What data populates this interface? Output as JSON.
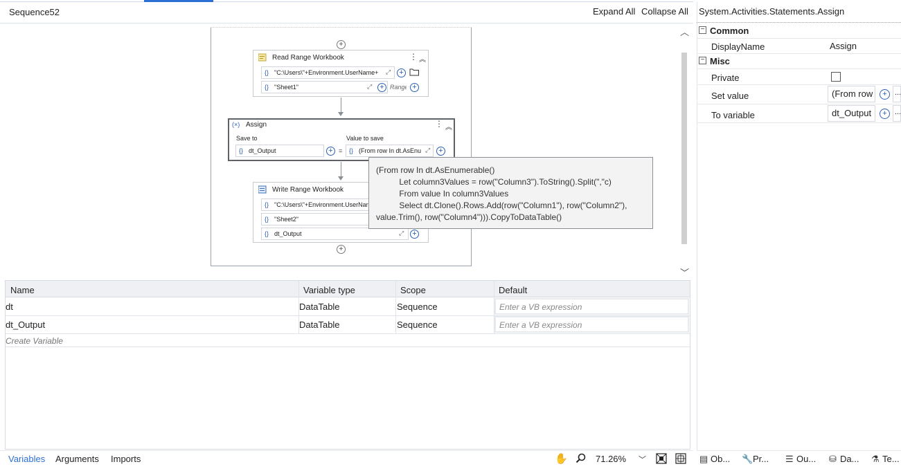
{
  "header": {
    "title": "Sequence52",
    "expand_all": "Expand All",
    "collapse_all": "Collapse All"
  },
  "designer": {
    "read_range": {
      "title": "Read Range Workbook",
      "path_value": "\"C:\\Users\\\"+Environment.UserName+\"",
      "sheet_value": "\"Sheet1\"",
      "range_placeholder": "Range"
    },
    "assign": {
      "title": "Assign",
      "save_to_label": "Save to",
      "value_to_save_label": "Value to save",
      "save_to_value": "dt_Output",
      "equals": "=",
      "value_value": "(From row In dt.AsEnu"
    },
    "write_range": {
      "title": "Write Range Workbook",
      "path_value": "\"C:\\Users\\\"+Environment.UserNar",
      "sheet_value": "\"Sheet2\"",
      "data_value": "dt_Output"
    },
    "tooltip_lines": [
      "(From row In dt.AsEnumerable()",
      "          Let column3Values = row(\"Column3\").ToString().Split(\",\"c)",
      "          From value In column3Values",
      "          Select dt.Clone().Rows.Add(row(\"Column1\"), row(\"Column2\"),",
      "value.Trim(), row(\"Column4\"))).CopyToDataTable()"
    ]
  },
  "variables": {
    "headers": [
      "Name",
      "Variable type",
      "Scope",
      "Default"
    ],
    "rows": [
      {
        "name": "dt",
        "type": "DataTable",
        "scope": "Sequence",
        "default_placeholder": "Enter a VB expression"
      },
      {
        "name": "dt_Output",
        "type": "DataTable",
        "scope": "Sequence",
        "default_placeholder": "Enter a VB expression"
      }
    ],
    "create_label": "Create Variable"
  },
  "bottom_bar": {
    "tabs": [
      "Variables",
      "Arguments",
      "Imports"
    ],
    "zoom": "71.26%"
  },
  "properties": {
    "title": "System.Activities.Statements.Assign",
    "common_label": "Common",
    "misc_label": "Misc",
    "display_name_label": "DisplayName",
    "display_name_value": "Assign",
    "private_label": "Private",
    "set_value_label": "Set value",
    "set_value_value": "(From row",
    "to_variable_label": "To variable",
    "to_variable_value": "dt_Output",
    "ellipsis": "..."
  },
  "right_tabs": [
    "Ob...",
    "Pr...",
    "Ou...",
    "Da...",
    "Te..."
  ],
  "colors": {
    "accent": "#2b6fd6",
    "tooltip_bg": "#f3f3f3",
    "header_bg": "#eef0f4"
  }
}
